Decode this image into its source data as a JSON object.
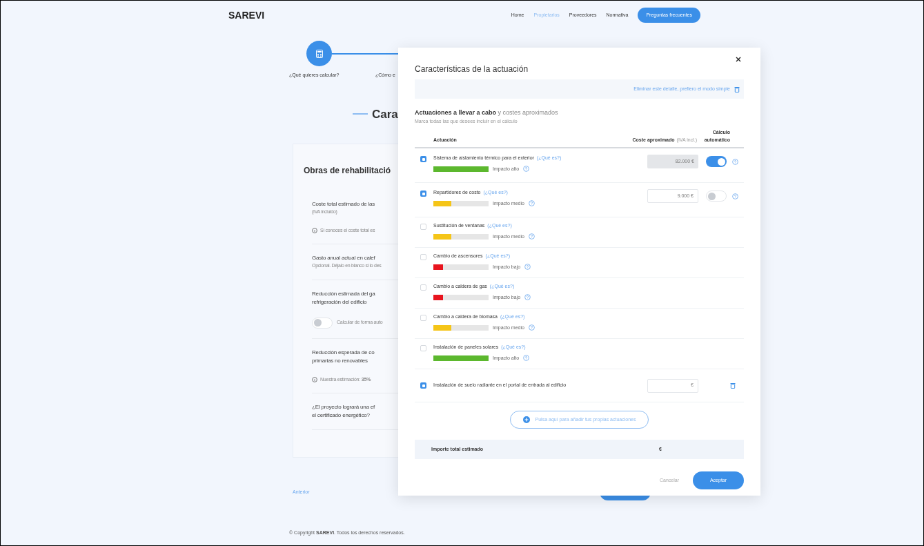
{
  "header": {
    "logo": "SAREVI",
    "nav": [
      {
        "label": "Home",
        "selected": false
      },
      {
        "label": "Propietarios",
        "selected": true
      },
      {
        "label": "Proveedores",
        "selected": false
      },
      {
        "label": "Normativa",
        "selected": false
      }
    ],
    "cta": "Preguntas frecuentes"
  },
  "stepper": {
    "steps": [
      "¿Qué quieres calcular?",
      "¿Cómo e"
    ]
  },
  "page_heading": "Cara",
  "card": {
    "title": "Obras de rehabilitació",
    "fields": [
      {
        "kind": "info",
        "label": "Coste total estimado de las",
        "sublabel": "(IVA incluido)",
        "note": "Si conoces el coste total es"
      },
      {
        "kind": "plain",
        "label": "Gasto anual actual en calef",
        "sublabel": "Opcional. Déjalo en blanco si lo des"
      },
      {
        "kind": "toggle",
        "label": "Reducción estimada del ga",
        "label2": "refrigeración del edificio",
        "note": "Calcular de forma auto",
        "on": false
      },
      {
        "kind": "info",
        "label": "Reducción esperada de co",
        "label2": "primarias no renovables",
        "note": "Nuestra estimación: **35%**"
      },
      {
        "kind": "plain",
        "label": "¿El proyecto logrará una ef",
        "label2": "el certificado energético?"
      }
    ]
  },
  "back_link": "Anterior",
  "footer": "© Copyright **SAREVI**. Todos los derechos reservados.",
  "modal": {
    "title": "Características de la actuación",
    "simple_link": "Eliminar este detalle, prefiero el modo simple",
    "section_title": "**Actuaciones a llevar a cabo** y costes aproximados",
    "section_hint": "Marca todas las que desees incluir en el cálculo",
    "columns": {
      "name": "Actuación",
      "cost": "Coste aproximado",
      "cost_note": "(IVA incl.)",
      "auto": "Cálculo automático"
    },
    "rows": [
      {
        "kind": "catalog",
        "name": "Sistema de aislamiento térmico para el exterior",
        "link": "(¿Qué es?)",
        "checked": true,
        "level": 1,
        "color": "#5cb82e",
        "impact": "Impacto alto",
        "cost": "82.000 €",
        "auto": true
      },
      {
        "kind": "catalog",
        "name": "Repartidores de costo",
        "link": "(¿Qué es?)",
        "checked": true,
        "level": 0.33,
        "color": "#f5c518",
        "impact": "Impacto medio",
        "cost": "9.000 €",
        "auto": false
      },
      {
        "kind": "catalog",
        "name": "Sustitución de ventanas",
        "link": "(¿Qué es?)",
        "checked": false,
        "level": 0.33,
        "color": "#f5c518",
        "impact": "Impacto medio"
      },
      {
        "kind": "catalog",
        "name": "Cambio de ascensores",
        "link": "(¿Qué es?)",
        "checked": false,
        "level": 0.17,
        "color": "#e8141e",
        "impact": "Impacto bajo"
      },
      {
        "kind": "catalog",
        "name": "Cambio a caldera de gas",
        "link": "(¿Qué es?)",
        "checked": false,
        "level": 0.17,
        "color": "#e8141e",
        "impact": "Impacto bajo"
      },
      {
        "kind": "catalog",
        "name": "Cambio a caldera de biomasa",
        "link": "(¿Qué es?)",
        "checked": false,
        "level": 0.33,
        "color": "#f5c518",
        "impact": "Impacto medio"
      },
      {
        "kind": "catalog",
        "name": "Instalación de paneles solares",
        "link": "(¿Qué es?)",
        "checked": false,
        "level": 1,
        "color": "#5cb82e",
        "impact": "Impacto alto"
      },
      {
        "kind": "custom",
        "name": "Instalación de suelo radiante en el portal de entrada al edificio",
        "checked": true,
        "unit": "€"
      }
    ],
    "add_button": "Pulsa aquí para añadir tus propias actuaciones",
    "total_label": "Importe total estimado",
    "total_unit": "€",
    "buttons": {
      "cancel": "Cancelar",
      "accept": "Aceptar"
    }
  }
}
